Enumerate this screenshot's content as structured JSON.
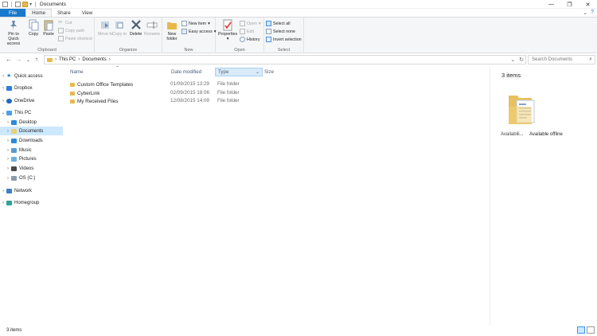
{
  "window": {
    "title": "Documents",
    "minimize": "—",
    "maximize": "❐",
    "close": "✕"
  },
  "tabs": [
    "File",
    "Home",
    "Share",
    "View"
  ],
  "ribbon": {
    "clipboard": {
      "pin": "Pin to Quick access",
      "copy": "Copy",
      "paste": "Paste",
      "cut": "Cut",
      "copy_path": "Copy path",
      "paste_shortcut": "Paste shortcut",
      "label": "Clipboard"
    },
    "organize": {
      "move_to": "Move to",
      "copy_to": "Copy to",
      "delete": "Delete",
      "rename": "Rename",
      "label": "Organize"
    },
    "new": {
      "new_folder": "New folder",
      "new_item": "New item",
      "easy_access": "Easy access",
      "label": "New"
    },
    "open": {
      "properties": "Properties",
      "open": "Open",
      "edit": "Edit",
      "history": "History",
      "label": "Open"
    },
    "select": {
      "select_all": "Select all",
      "select_none": "Select none",
      "invert": "Invert selection",
      "label": "Select"
    }
  },
  "address": {
    "crumbs": [
      "This PC",
      "Documents"
    ],
    "search_placeholder": "Search Documents"
  },
  "nav": {
    "items": [
      {
        "label": "Quick access",
        "level": 0
      },
      {
        "label": "Dropbox",
        "level": 0
      },
      {
        "label": "OneDrive",
        "level": 0
      },
      {
        "label": "This PC",
        "level": 0
      },
      {
        "label": "Desktop",
        "level": 1
      },
      {
        "label": "Documents",
        "level": 1
      },
      {
        "label": "Downloads",
        "level": 1
      },
      {
        "label": "Music",
        "level": 1
      },
      {
        "label": "Pictures",
        "level": 1
      },
      {
        "label": "Videos",
        "level": 1
      },
      {
        "label": "OS (C:)",
        "level": 1
      },
      {
        "label": "Network",
        "level": 0
      },
      {
        "label": "Homegroup",
        "level": 0
      }
    ]
  },
  "columns": {
    "name": "Name",
    "date": "Date modified",
    "type": "Type",
    "size": "Size"
  },
  "files": [
    {
      "name": "Custom Office Templates",
      "date": "01/09/2015 13:29",
      "type": "File folder"
    },
    {
      "name": "CyberLink",
      "date": "02/09/2015 18:06",
      "type": "File folder"
    },
    {
      "name": "My Received Files",
      "date": "12/08/2015 14:09",
      "type": "File folder"
    }
  ],
  "details": {
    "count": "3 items",
    "availability": "Availabili...",
    "availability_value": "Available offline"
  },
  "status": {
    "count": "3 items"
  },
  "colors": {
    "accent": "#1979ca",
    "selected": "#cce8ff",
    "folder": "#e8b84a"
  }
}
